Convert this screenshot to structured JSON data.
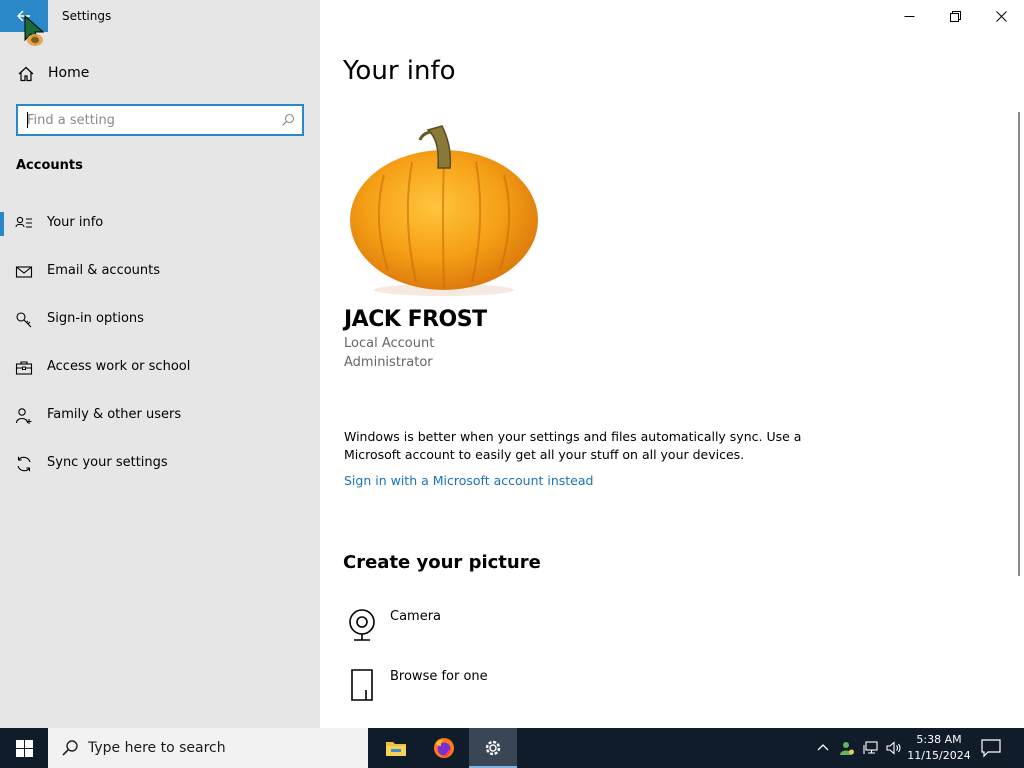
{
  "window": {
    "title": "Settings",
    "controls": [
      "minimize",
      "restore",
      "close"
    ]
  },
  "sidebar": {
    "home_label": "Home",
    "search": {
      "placeholder": "Find a setting",
      "value": ""
    },
    "section_title": "Accounts",
    "items": [
      {
        "label": "Your info",
        "icon": "person-list-icon",
        "active": true
      },
      {
        "label": "Email & accounts",
        "icon": "mail-icon",
        "active": false
      },
      {
        "label": "Sign-in options",
        "icon": "key-icon",
        "active": false
      },
      {
        "label": "Access work or school",
        "icon": "briefcase-icon",
        "active": false
      },
      {
        "label": "Family & other users",
        "icon": "person-add-icon",
        "active": false
      },
      {
        "label": "Sync your settings",
        "icon": "sync-icon",
        "active": false
      }
    ]
  },
  "main": {
    "title": "Your info",
    "user": {
      "name": "JACK FROST",
      "account_type": "Local Account",
      "role": "Administrator"
    },
    "sync_message": "Windows is better when your settings and files automatically sync. Use a Microsoft account to easily get all your stuff on all your devices.",
    "ms_link": "Sign in with a Microsoft account instead",
    "picture_section_title": "Create your picture",
    "picture_options": [
      {
        "label": "Camera",
        "icon": "camera-icon"
      },
      {
        "label": "Browse for one",
        "icon": "browse-file-icon"
      }
    ]
  },
  "taskbar": {
    "search_placeholder": "Type here to search",
    "apps": [
      "file-explorer-icon",
      "firefox-icon",
      "settings-gear-icon"
    ],
    "clock": {
      "time": "5:38 AM",
      "date": "11/15/2024"
    }
  },
  "colors": {
    "accent": "#2b88c8",
    "sidebar_bg": "#e6e6e6",
    "link": "#1a73b8",
    "taskbar_bg": "#101c2a"
  }
}
